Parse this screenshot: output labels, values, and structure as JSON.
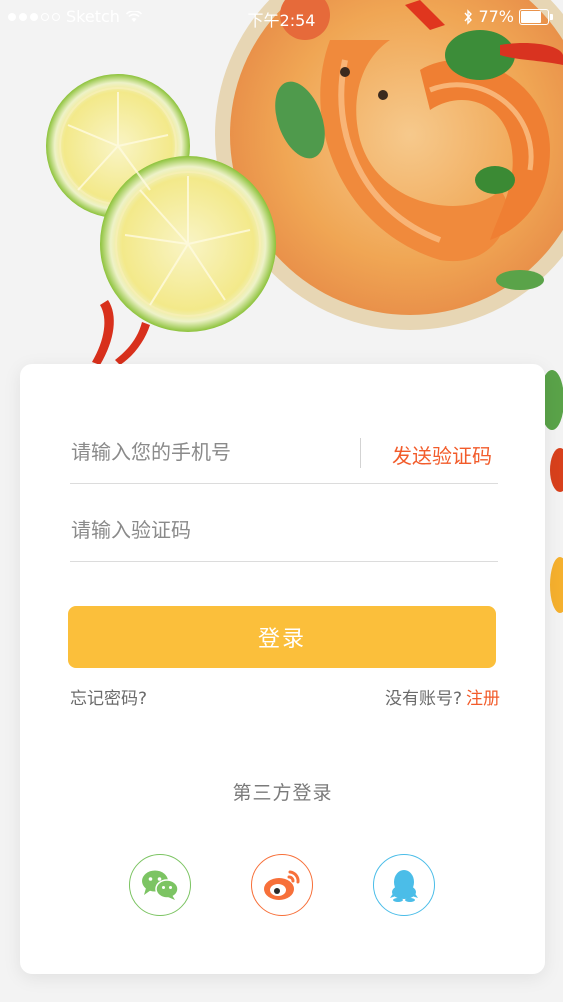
{
  "status_bar": {
    "carrier": "Sketch",
    "time": "下午2:54",
    "battery": "77%"
  },
  "login_form": {
    "phone_placeholder": "请输入您的手机号",
    "send_code_label": "发送验证码",
    "code_placeholder": "请输入验证码",
    "login_label": "登录",
    "forgot_label": "忘记密码?",
    "no_account_label": "没有账号?",
    "register_label": "注册",
    "third_party_title": "第三方登录"
  },
  "social_logins": [
    "wechat-icon",
    "weibo-icon",
    "qq-icon"
  ],
  "colors": {
    "accent": "#fbbf3b",
    "link": "#f25c2b",
    "wechat": "#7cc463",
    "weibo": "#f7703a",
    "qq": "#4bbde8"
  }
}
